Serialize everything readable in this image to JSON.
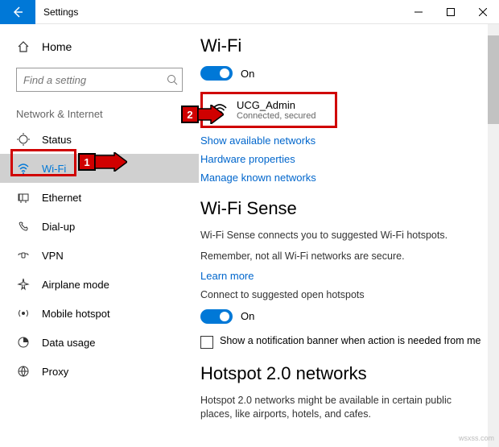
{
  "window": {
    "title": "Settings"
  },
  "sidebar": {
    "home": "Home",
    "search_placeholder": "Find a setting",
    "category": "Network & Internet",
    "items": [
      {
        "label": "Status"
      },
      {
        "label": "Wi-Fi"
      },
      {
        "label": "Ethernet"
      },
      {
        "label": "Dial-up"
      },
      {
        "label": "VPN"
      },
      {
        "label": "Airplane mode"
      },
      {
        "label": "Mobile hotspot"
      },
      {
        "label": "Data usage"
      },
      {
        "label": "Proxy"
      }
    ]
  },
  "main": {
    "wifi": {
      "heading": "Wi-Fi",
      "toggle_label": "On",
      "network": {
        "ssid": "UCG_Admin",
        "status": "Connected, secured"
      },
      "show_available": "Show available networks",
      "hw_props": "Hardware properties",
      "manage_known": "Manage known networks"
    },
    "sense": {
      "heading": "Wi-Fi Sense",
      "line1": "Wi-Fi Sense connects you to suggested Wi-Fi hotspots.",
      "line2": "Remember, not all Wi-Fi networks are secure.",
      "learn_more": "Learn more",
      "connect_open": "Connect to suggested open hotspots",
      "open_toggle": "On",
      "checkbox": "Show a notification banner when action is needed from me"
    },
    "hotspot2": {
      "heading": "Hotspot 2.0 networks",
      "line": "Hotspot 2.0 networks might be available in certain public places, like airports, hotels, and cafes."
    }
  },
  "annotations": {
    "a1": "1",
    "a2": "2"
  },
  "watermark": "wsxss.com"
}
